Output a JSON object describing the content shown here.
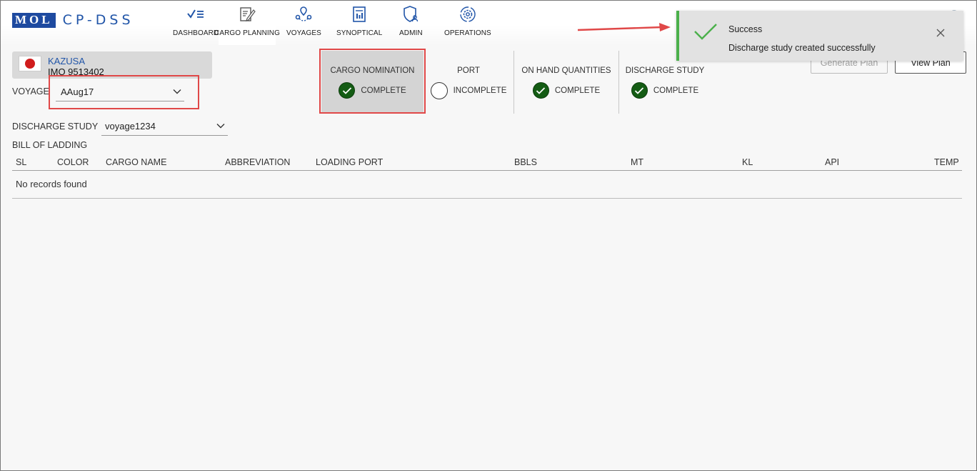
{
  "header": {
    "logo_mark": "MOL",
    "app_name": "CP-DSS",
    "nav": [
      {
        "label": "DASHBOARD",
        "icon": "checklist-icon"
      },
      {
        "label": "CARGO PLANNING",
        "icon": "edit-document-icon",
        "active": true
      },
      {
        "label": "VOYAGES",
        "icon": "route-icon"
      },
      {
        "label": "SYNOPTICAL",
        "icon": "report-icon"
      },
      {
        "label": "ADMIN",
        "icon": "shield-user-icon"
      },
      {
        "label": "OPERATIONS",
        "icon": "gear-cycle-icon"
      }
    ]
  },
  "vessel": {
    "name": "KAZUSA",
    "imo": "IMO 9513402",
    "flag": "japan-flag"
  },
  "voyage": {
    "label": "VOYAGE",
    "value": "AAug17"
  },
  "discharge_study": {
    "label": "DISCHARGE STUDY",
    "value": "voyage1234"
  },
  "bill_of_lading": {
    "title": "BILL OF LADDING",
    "columns": [
      "SL",
      "COLOR",
      "CARGO NAME",
      "ABBREVIATION",
      "LOADING PORT",
      "BBLS",
      "MT",
      "KL",
      "API",
      "TEMP"
    ],
    "empty_text": "No records found"
  },
  "steps": [
    {
      "label": "CARGO NOMINATION",
      "status": "COMPLETE",
      "complete": true
    },
    {
      "label": "PORT",
      "status": "INCOMPLETE",
      "complete": false
    },
    {
      "label": "ON HAND QUANTITIES",
      "status": "COMPLETE",
      "complete": true
    },
    {
      "label": "DISCHARGE STUDY",
      "status": "COMPLETE",
      "complete": true
    }
  ],
  "buttons": {
    "generate_plan": "Generate Plan",
    "view_plan": "View Plan"
  },
  "toast": {
    "title": "Success",
    "message": "Discharge study created successfully",
    "accent": "#4bb04b"
  },
  "colors": {
    "brand": "#1e4aa0",
    "complete": "#145c14",
    "highlight": "#e04848"
  }
}
